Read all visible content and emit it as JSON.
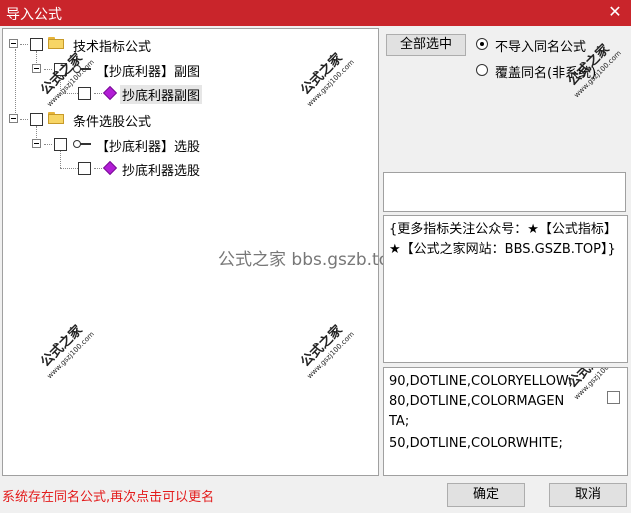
{
  "window": {
    "title": "导入公式",
    "close_glyph": "✕"
  },
  "tree": {
    "nodes": [
      {
        "label": "技术指标公式"
      },
      {
        "label": "【抄底利器】副图"
      },
      {
        "label": "抄底利器副图"
      },
      {
        "label": "条件选股公式"
      },
      {
        "label": "【抄底利器】选股"
      },
      {
        "label": "抄底利器选股"
      }
    ]
  },
  "watermarks": {
    "stamp_text": "公式之家",
    "stamp_url": "www.gszj100.com",
    "center_text": "公式之家 bbs.gszb.top"
  },
  "buttons": {
    "select_all": "全部选中",
    "ok": "确定",
    "cancel": "取消"
  },
  "options": {
    "no_import_same_name": "不导入同名公式",
    "overwrite_same_name": "覆盖同名(非系统)",
    "selected": "no_import_same_name"
  },
  "description": {
    "text": "{更多指标关注公众号：★【公式指标】★【公式之家网站：BBS.GSZB.TOP】}"
  },
  "source_preview": {
    "lines": [
      "90,DOTLINE,COLORYELLOW;",
      "80,DOTLINE,COLORMAGEN",
      "TA;",
      "50,DOTLINE,COLORWHITE;"
    ]
  },
  "status": {
    "message": "系统存在同名公式,再次点击可以更名"
  },
  "colors": {
    "titlebar": "#c9252b",
    "status_text": "#e31b1b",
    "gem": "#b21dd6",
    "folder": "#f7d565"
  }
}
